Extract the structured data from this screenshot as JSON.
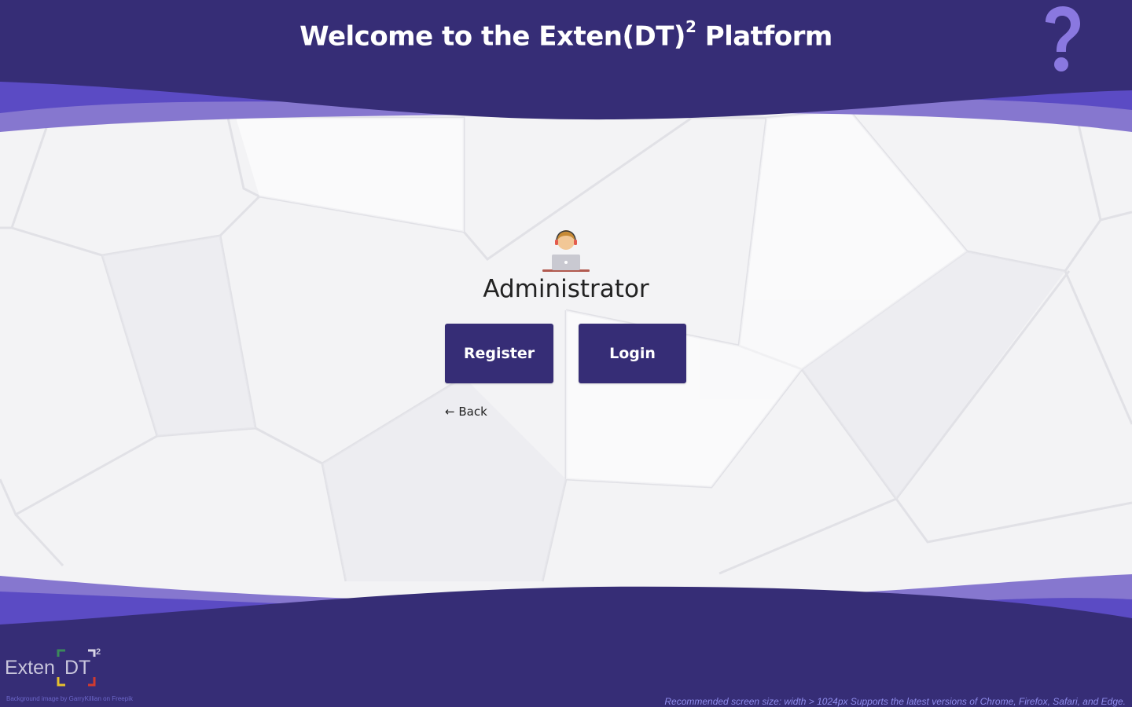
{
  "header": {
    "title_prefix": "Welcome to the Exten(DT)",
    "title_sup": "2",
    "title_suffix": " Platform",
    "help_icon": "question-mark-icon"
  },
  "main": {
    "avatar_icon": "administrator-avatar-icon",
    "role_title": "Administrator",
    "register_label": "Register",
    "login_label": "Login",
    "back_label": "← Back"
  },
  "footer": {
    "logo_text": "Exten",
    "logo_dt": "DT",
    "logo_sup": "2",
    "credit": "Background image by GarryKillian on Freepik",
    "recommendation": "Recommended screen size: width > 1024px Supports the latest versions of Chrome, Firefox, Safari, and Edge."
  },
  "colors": {
    "primary": "#362d76",
    "accent": "#5b4bc4",
    "accent_light": "#8677cf",
    "help_icon": "#8a78e0",
    "background": "#f4f4f6"
  }
}
